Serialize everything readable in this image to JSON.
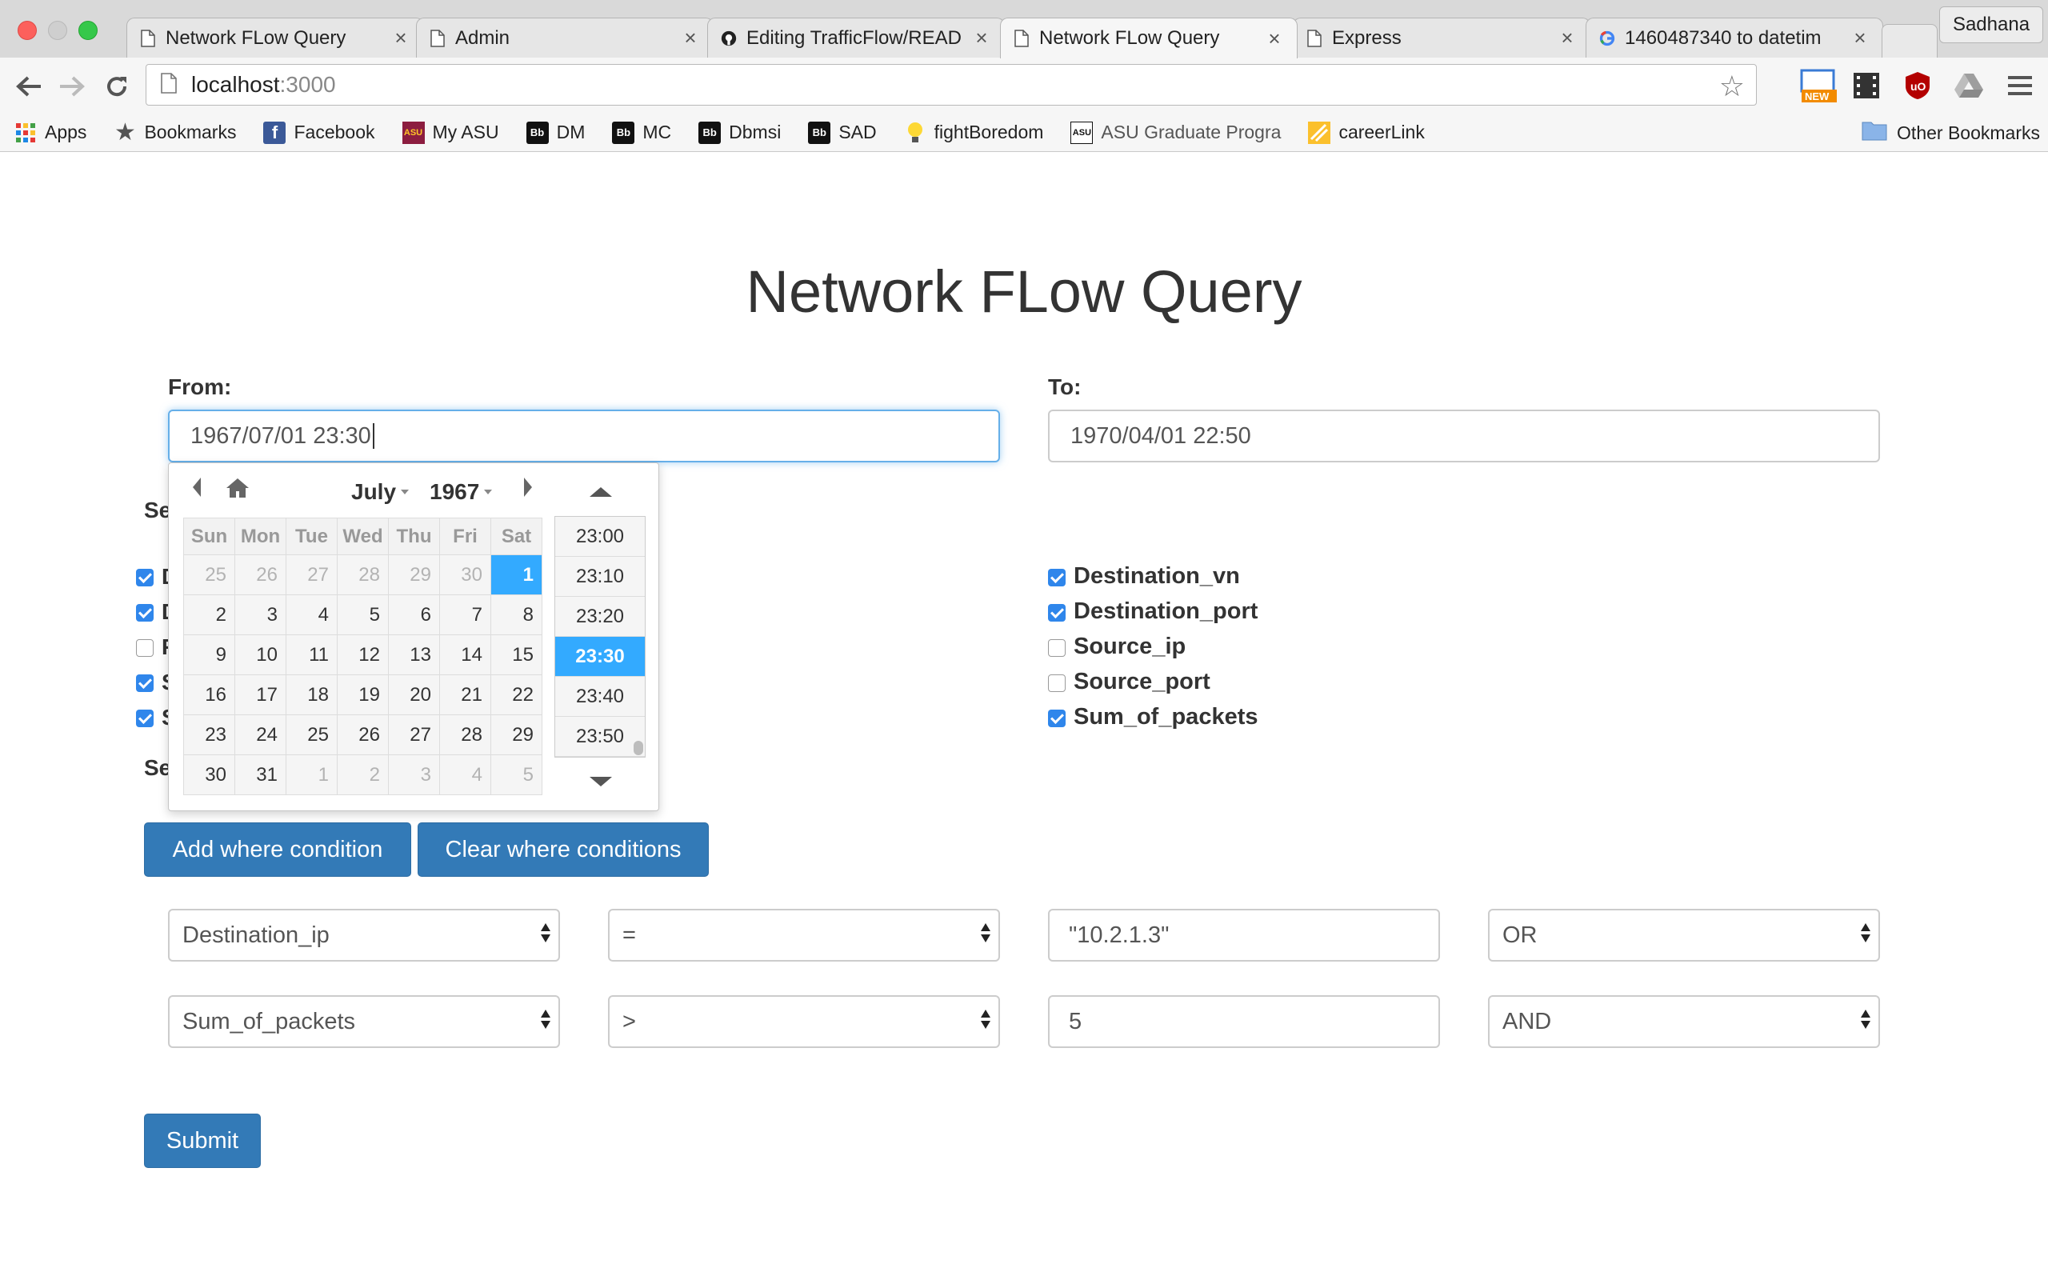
{
  "browser": {
    "tabs": [
      {
        "title": "Network FLow Query",
        "icon": "page-icon",
        "active": false
      },
      {
        "title": "Admin",
        "icon": "page-icon",
        "active": false
      },
      {
        "title": "Editing TrafficFlow/READ",
        "icon": "github-icon",
        "active": false
      },
      {
        "title": "Network FLow Query",
        "icon": "page-icon",
        "active": true
      },
      {
        "title": "Express",
        "icon": "page-icon",
        "active": false
      },
      {
        "title": "1460487340 to datetim",
        "icon": "google-icon",
        "active": false
      }
    ],
    "profile": "Sadhana",
    "url_host": "localhost",
    "url_port": ":3000",
    "bookmarks": [
      "Apps",
      "Bookmarks",
      "Facebook",
      "My ASU",
      "DM",
      "MC",
      "Dbmsi",
      "SAD",
      "fightBoredom",
      "ASU Graduate Progra",
      "careerLink"
    ],
    "bookmark_icon_text": {
      "my_asu": "ASU",
      "bb": "Bb",
      "new_badge": "NEW"
    },
    "other_bookmarks": "Other Bookmarks"
  },
  "page": {
    "title": "Network FLow Query",
    "from_label": "From:",
    "from_value": "1967/07/01 23:30",
    "to_label": "To:",
    "to_value": "1970/04/01 22:50",
    "partial_left_labels": [
      "Se",
      "Se"
    ],
    "partial_checkbox_letters": [
      "D",
      "D",
      "F",
      "S",
      "S"
    ],
    "left_checks": [
      true,
      true,
      false,
      true,
      true
    ],
    "columns_right": [
      {
        "label": "Destination_vn",
        "checked": true
      },
      {
        "label": "Destination_port",
        "checked": true
      },
      {
        "label": "Source_ip",
        "checked": false
      },
      {
        "label": "Source_port",
        "checked": false
      },
      {
        "label": "Sum_of_packets",
        "checked": true
      }
    ],
    "add_where_label": "Add where condition",
    "clear_where_label": "Clear where conditions",
    "conditions": [
      {
        "field": "Destination_ip",
        "op": "=",
        "value": "\"10.2.1.3\"",
        "joiner": "OR"
      },
      {
        "field": "Sum_of_packets",
        "op": ">",
        "value": "5",
        "joiner": "AND"
      }
    ],
    "submit_label": "Submit"
  },
  "datepicker": {
    "month": "July",
    "year": "1967",
    "weekdays": [
      "Sun",
      "Mon",
      "Tue",
      "Wed",
      "Thu",
      "Fri",
      "Sat"
    ],
    "weeks": [
      [
        "25",
        "26",
        "27",
        "28",
        "29",
        "30",
        "1"
      ],
      [
        "2",
        "3",
        "4",
        "5",
        "6",
        "7",
        "8"
      ],
      [
        "9",
        "10",
        "11",
        "12",
        "13",
        "14",
        "15"
      ],
      [
        "16",
        "17",
        "18",
        "19",
        "20",
        "21",
        "22"
      ],
      [
        "23",
        "24",
        "25",
        "26",
        "27",
        "28",
        "29"
      ],
      [
        "30",
        "31",
        "1",
        "2",
        "3",
        "4",
        "5"
      ]
    ],
    "selected_day": "1",
    "times": [
      "23:00",
      "23:10",
      "23:20",
      "23:30",
      "23:40",
      "23:50"
    ],
    "selected_time": "23:30"
  },
  "colors": {
    "accent": "#337ab7",
    "selection": "#33aaff",
    "checkbox": "#2f86eb",
    "focus": "#66afe9"
  }
}
